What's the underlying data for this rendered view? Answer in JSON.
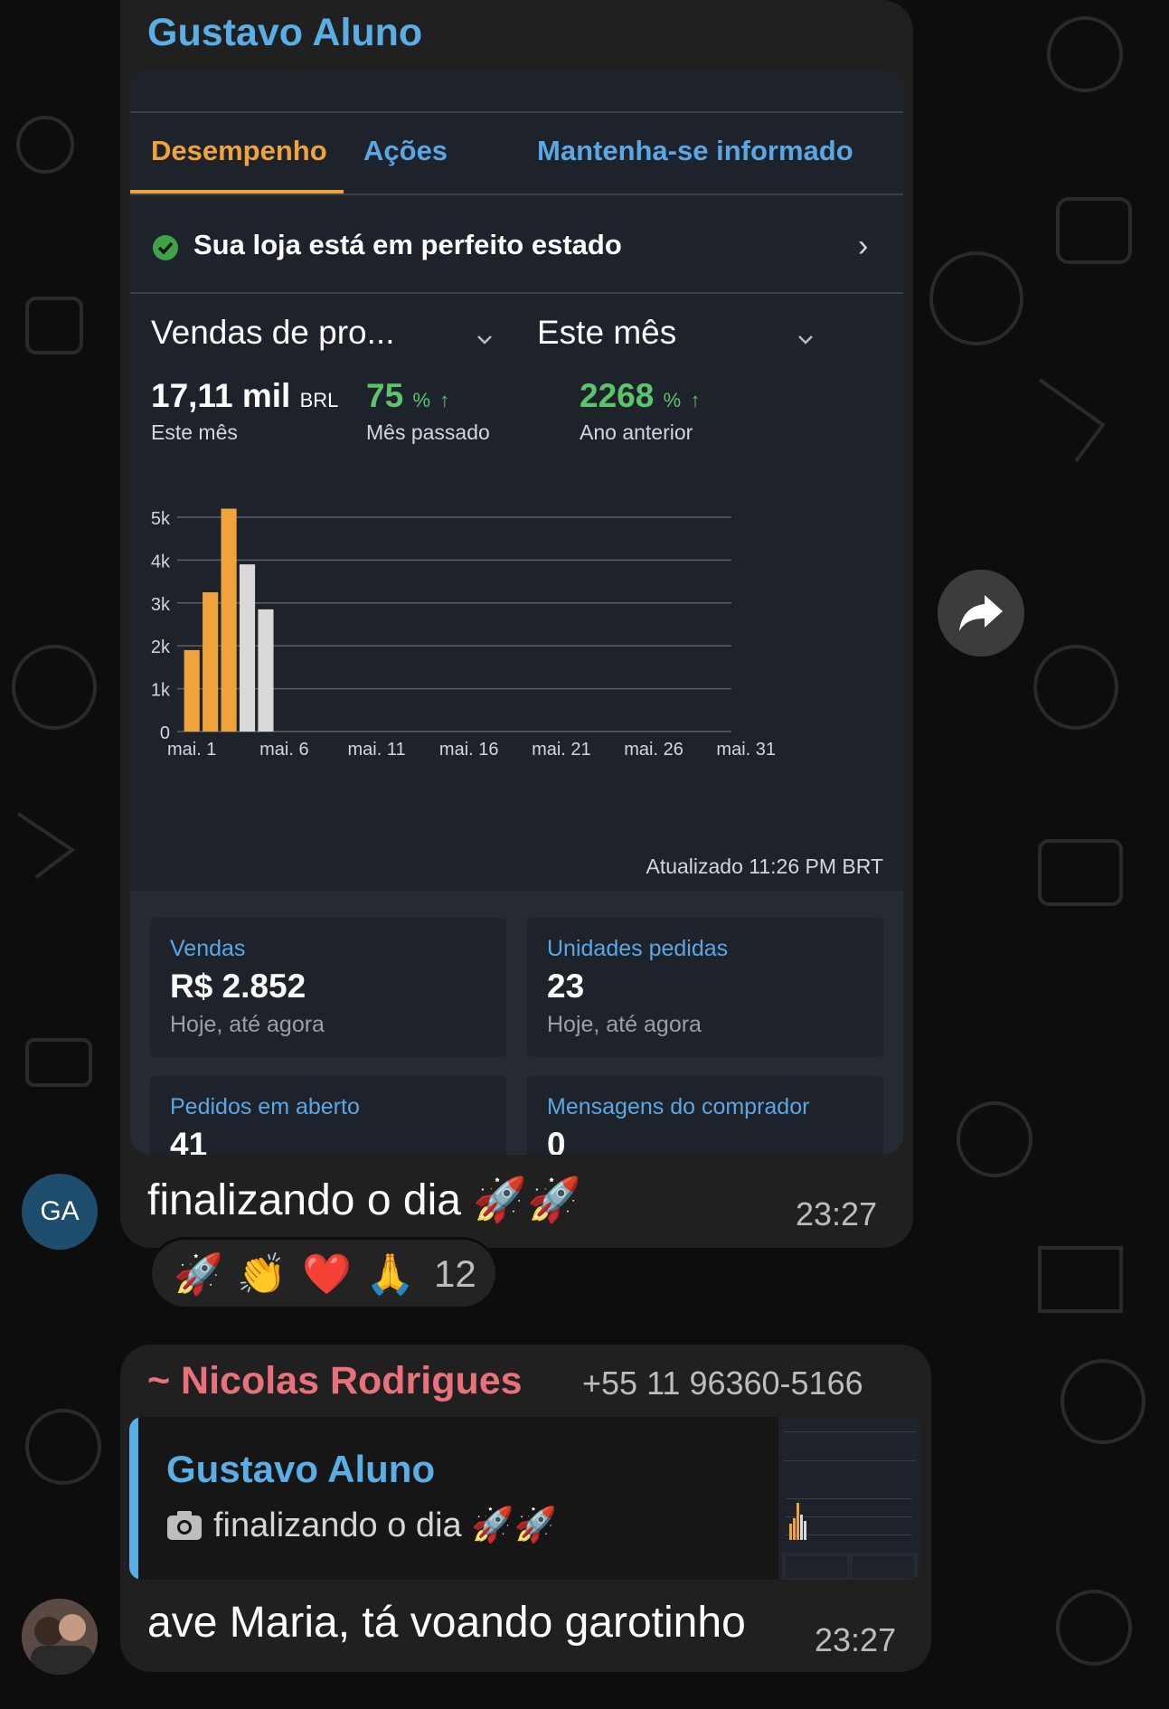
{
  "message1": {
    "sender": "Gustavo Aluno",
    "avatar_initials": "GA",
    "caption": "finalizando o dia 🚀🚀",
    "time": "23:27",
    "screenshot": {
      "tabs": [
        "Desempenho",
        "Ações",
        "Mantenha-se informado"
      ],
      "active_tab": "Desempenho",
      "status": "Sua loja está em perfeito estado",
      "metric_dropdown": "Vendas de pro...",
      "period_dropdown": "Este mês",
      "stats": [
        {
          "value": "17,11 mil",
          "unit": "BRL",
          "label": "Este mês"
        },
        {
          "value": "75",
          "unit": "%",
          "label": "Mês passado"
        },
        {
          "value": "2268",
          "unit": "%",
          "label": "Ano anterior"
        }
      ],
      "updated": "Atualizado 11:26 PM BRT",
      "cards": [
        {
          "label": "Vendas",
          "value": "R$ 2.852",
          "sub": "Hoje, até agora"
        },
        {
          "label": "Unidades pedidas",
          "value": "23",
          "sub": "Hoje, até agora"
        },
        {
          "label": "Pedidos em aberto",
          "value": "41",
          "sub": ""
        },
        {
          "label": "Mensagens do comprador",
          "value": "0",
          "sub": ""
        }
      ],
      "colors": {
        "accent": "#f0a33a",
        "link": "#5aa7e6",
        "positive": "#5cc46b"
      }
    }
  },
  "chart_data": {
    "type": "bar",
    "x_ticks": [
      "mai. 1",
      "mai. 6",
      "mai. 11",
      "mai. 16",
      "mai. 21",
      "mai. 26",
      "mai. 31"
    ],
    "y_ticks": [
      "0",
      "1k",
      "2k",
      "3k",
      "4k",
      "5k"
    ],
    "ylim": [
      0,
      5000
    ],
    "bars": [
      {
        "day": 1,
        "value": 1900,
        "color": "#f0a33a"
      },
      {
        "day": 2,
        "value": 3250,
        "color": "#f0a33a"
      },
      {
        "day": 3,
        "value": 5200,
        "color": "#f0a33a"
      },
      {
        "day": 4,
        "value": 3900,
        "color": "#d9d9d9"
      },
      {
        "day": 5,
        "value": 2850,
        "color": "#d9d9d9"
      }
    ]
  },
  "reactions": {
    "emojis": [
      "🚀",
      "👏",
      "❤️",
      "🙏"
    ],
    "count": "12"
  },
  "message2": {
    "sender": "~ Nicolas Rodrigues",
    "phone": "+55 11 96360-5166",
    "quote_author": "Gustavo Aluno",
    "quote_text": "finalizando o dia 🚀🚀",
    "text": "ave Maria, tá voando garotinho",
    "time": "23:27"
  },
  "icons": {
    "forward": "forward-arrow-icon",
    "camera": "camera-icon",
    "check": "check-circle-icon"
  }
}
